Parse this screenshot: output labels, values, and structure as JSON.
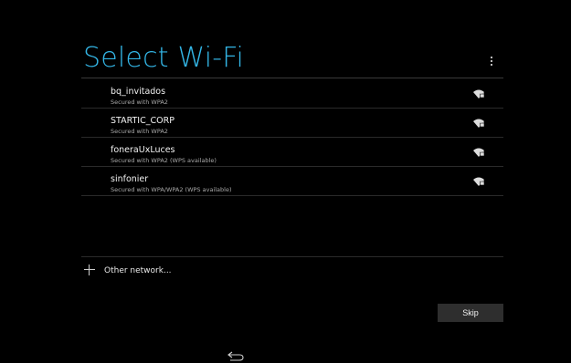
{
  "header": {
    "title": "Select Wi-Fi",
    "accent_color": "#33b5e5",
    "overflow_icon": "overflow-menu-icon"
  },
  "networks": [
    {
      "ssid": "bq_invitados",
      "security": "Secured with WPA2",
      "icon": "wifi-secured-icon"
    },
    {
      "ssid": "STARTIC_CORP",
      "security": "Secured with WPA2",
      "icon": "wifi-secured-icon"
    },
    {
      "ssid": "foneraUxLuces",
      "security": "Secured with WPA2 (WPS available)",
      "icon": "wifi-secured-icon"
    },
    {
      "ssid": "sinfonier",
      "security": "Secured with WPA/WPA2 (WPS available)",
      "icon": "wifi-secured-icon"
    }
  ],
  "other_network": {
    "label": "Other network...",
    "icon": "plus-icon"
  },
  "actions": {
    "skip_label": "Skip"
  },
  "navbar": {
    "back_icon": "back-icon"
  }
}
